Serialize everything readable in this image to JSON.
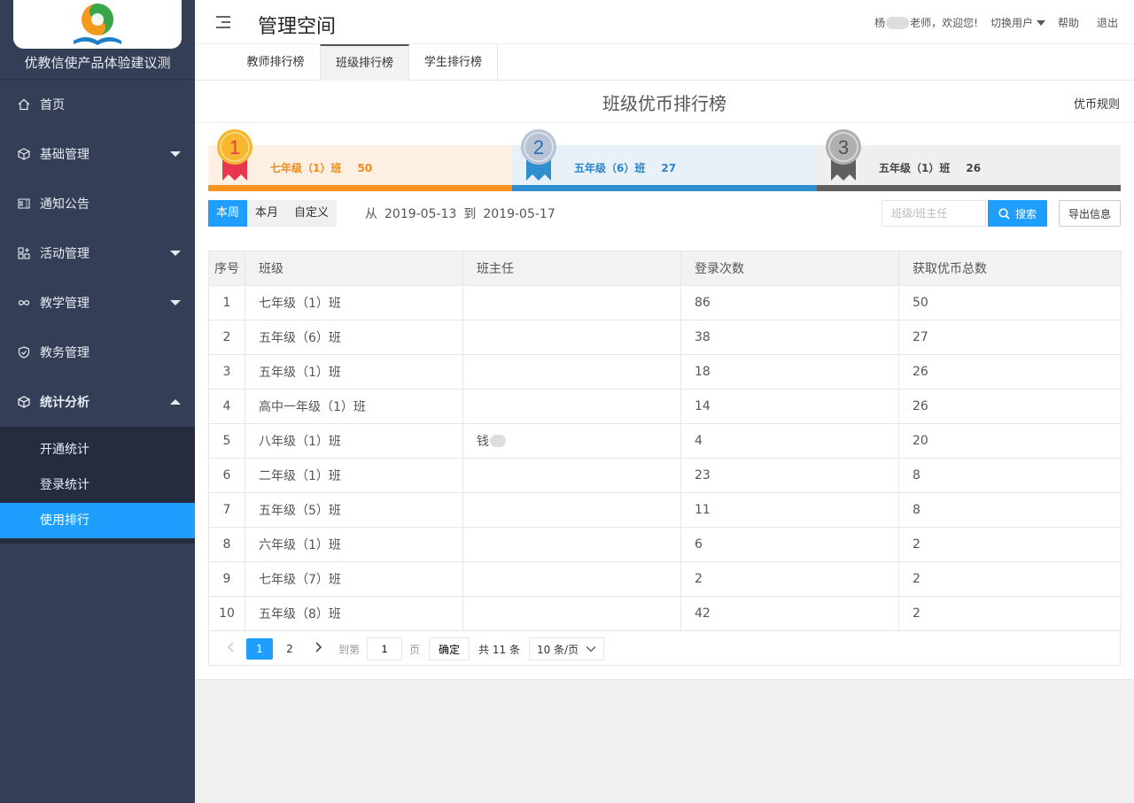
{
  "sidebar": {
    "org_name": "优教信使产品体验建议测",
    "items": [
      {
        "label": "首页",
        "icon": "home-icon"
      },
      {
        "label": "基础管理",
        "icon": "cube-icon",
        "caret": "down"
      },
      {
        "label": "通知公告",
        "icon": "notice-icon"
      },
      {
        "label": "活动管理",
        "icon": "grid-icon",
        "caret": "down"
      },
      {
        "label": "教学管理",
        "icon": "infinity-icon",
        "caret": "down"
      },
      {
        "label": "教务管理",
        "icon": "shield-icon"
      },
      {
        "label": "统计分析",
        "icon": "cube-icon",
        "caret": "up"
      }
    ],
    "subitems": [
      {
        "label": "开通统计"
      },
      {
        "label": "登录统计"
      },
      {
        "label": "使用排行",
        "active": true
      }
    ]
  },
  "header": {
    "title": "管理空间",
    "welcome_prefix": "杨",
    "welcome_suffix": "老师，欢迎您!",
    "switch_user": "切换用户",
    "help": "帮助",
    "logout": "退出"
  },
  "tabs": [
    {
      "label": "教师排行榜"
    },
    {
      "label": "班级排行榜",
      "active": true
    },
    {
      "label": "学生排行榜"
    }
  ],
  "board": {
    "title": "班级优币排行榜",
    "rules": "优币规则"
  },
  "top3": [
    {
      "rank": "1",
      "class": "七年级（1）班",
      "score": "50",
      "text_color": "#f08a17",
      "bg": "#fdf0e2",
      "band": "#f7931e",
      "ribbon": "#e8384f",
      "medal": "#f5b82e"
    },
    {
      "rank": "2",
      "class": "五年级（6）班",
      "score": "27",
      "text_color": "#2a86c8",
      "bg": "#e8f0f8",
      "band": "#2f8fce",
      "ribbon": "#2f8fce",
      "medal": "#b8c4d6"
    },
    {
      "rank": "3",
      "class": "五年级（1）班",
      "score": "26",
      "text_color": "#444444",
      "bg": "#efefef",
      "band": "#5f5f5f",
      "ribbon": "#5f5f5f",
      "medal": "#b0b0b0"
    }
  ],
  "filters": {
    "periods": [
      {
        "label": "本周",
        "active": true
      },
      {
        "label": "本月"
      },
      {
        "label": "自定义"
      }
    ],
    "from_label": "从",
    "from_date": "2019-05-13",
    "to_label": "到",
    "to_date": "2019-05-17",
    "search_placeholder": "班级/班主任",
    "search_button": "搜索",
    "export_button": "导出信息"
  },
  "table": {
    "columns": [
      "序号",
      "班级",
      "班主任",
      "登录次数",
      "获取优币总数"
    ],
    "rows": [
      {
        "idx": "1",
        "class": "七年级（1）班",
        "teacher": "",
        "logins": "86",
        "coins": "50"
      },
      {
        "idx": "2",
        "class": "五年级（6）班",
        "teacher": "",
        "logins": "38",
        "coins": "27"
      },
      {
        "idx": "3",
        "class": "五年级（1）班",
        "teacher": "",
        "logins": "18",
        "coins": "26"
      },
      {
        "idx": "4",
        "class": "高中一年级（1）班",
        "teacher": "",
        "logins": "14",
        "coins": "26"
      },
      {
        "idx": "5",
        "class": "八年级（1）班",
        "teacher": "钱",
        "logins": "4",
        "coins": "20"
      },
      {
        "idx": "6",
        "class": "二年级（1）班",
        "teacher": "",
        "logins": "23",
        "coins": "8"
      },
      {
        "idx": "7",
        "class": "五年级（5）班",
        "teacher": "",
        "logins": "11",
        "coins": "8"
      },
      {
        "idx": "8",
        "class": "六年级（1）班",
        "teacher": "",
        "logins": "6",
        "coins": "2"
      },
      {
        "idx": "9",
        "class": "七年级（7）班",
        "teacher": "",
        "logins": "2",
        "coins": "2"
      },
      {
        "idx": "10",
        "class": "五年级（8）班",
        "teacher": "",
        "logins": "42",
        "coins": "2"
      }
    ]
  },
  "pagination": {
    "pages": [
      "1",
      "2"
    ],
    "current": "1",
    "goto_label": "到第",
    "goto_value": "1",
    "page_unit": "页",
    "confirm": "确定",
    "total": "共 11 条",
    "page_size": "10 条/页"
  },
  "colors": {
    "sidebar_bg": "#343e56",
    "accent": "#1e9fff"
  }
}
